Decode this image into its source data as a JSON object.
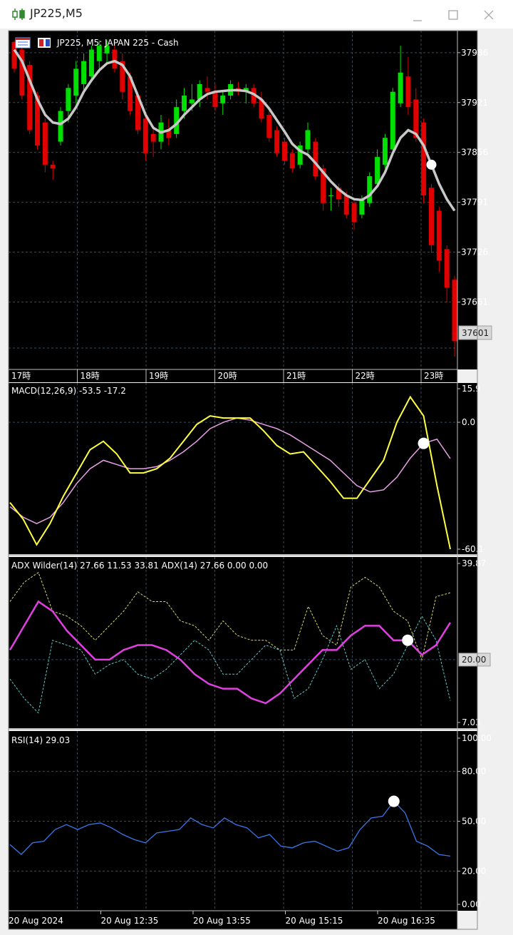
{
  "window": {
    "title": "JP225,M5",
    "title_icon": "candlestick-icon",
    "controls": [
      "minimize-icon",
      "maximize-icon",
      "close-icon"
    ]
  },
  "colors": {
    "background": "#000000",
    "grid": "#3a4a5a",
    "bull_candle": "#00e000",
    "bear_candle": "#e00000",
    "moving_average": "#c8c8c8",
    "macd_line": "#ffff40",
    "macd_signal": "#e8a0e8",
    "adx_line": "#e040e0",
    "plus_di": "#d8d870",
    "minus_di": "#60c8c8",
    "rsi_line": "#3878e8",
    "marker": "#ffffff"
  },
  "main_chart": {
    "header_icons": [
      "chart-window-icon",
      "one-click-trading-icon"
    ],
    "header": "JP225, M5:  JAPAN 225 - Cash",
    "price_ticks": [
      "37986",
      "37921",
      "37856",
      "37791",
      "37726",
      "37661",
      "37601"
    ],
    "current_price": "37601",
    "time_labels": [
      "17時",
      "18時",
      "19時",
      "20時",
      "21時",
      "22時",
      "23時"
    ]
  },
  "macd": {
    "label": "MACD(12,26,9) -53.5 -17.2",
    "ticks": [
      "15.9",
      "0.0",
      "-60.1"
    ]
  },
  "adx": {
    "label": "ADX Wilder(14) 27.66 11.53 33.81 ADX(14) 27.66 0.00 0.00",
    "ticks": [
      "39.87",
      "20.00",
      "7.03"
    ]
  },
  "rsi": {
    "label": "RSI(14) 29.03",
    "ticks": [
      "100.00",
      "80.00",
      "50.00",
      "20.00",
      "0.00"
    ]
  },
  "bottom_axis": [
    "20 Aug 2024",
    "20 Aug 12:35",
    "20 Aug 13:55",
    "20 Aug 15:15",
    "20 Aug 16:35"
  ],
  "chart_data": [
    {
      "type": "candlestick",
      "title": "JP225, M5:  JAPAN 225 - Cash",
      "ylim": [
        37575,
        38010
      ],
      "x_labels": [
        "17時",
        "18時",
        "19時",
        "20時",
        "21時",
        "22時",
        "23時"
      ],
      "candles": [
        {
          "o": 38000,
          "h": 38002,
          "l": 37960,
          "c": 37965
        },
        {
          "o": 37990,
          "h": 37995,
          "l": 37925,
          "c": 37930
        },
        {
          "o": 37970,
          "h": 37975,
          "l": 37880,
          "c": 37885
        },
        {
          "o": 37930,
          "h": 37935,
          "l": 37860,
          "c": 37865
        },
        {
          "o": 37895,
          "h": 37900,
          "l": 37830,
          "c": 37840
        },
        {
          "o": 37840,
          "h": 37845,
          "l": 37820,
          "c": 37835
        },
        {
          "o": 37870,
          "h": 37915,
          "l": 37865,
          "c": 37910
        },
        {
          "o": 37910,
          "h": 37945,
          "l": 37895,
          "c": 37940
        },
        {
          "o": 37930,
          "h": 37975,
          "l": 37920,
          "c": 37965
        },
        {
          "o": 37945,
          "h": 37985,
          "l": 37935,
          "c": 37975
        },
        {
          "o": 37955,
          "h": 37995,
          "l": 37950,
          "c": 37990
        },
        {
          "o": 37975,
          "h": 38002,
          "l": 37960,
          "c": 37995
        },
        {
          "o": 37985,
          "h": 38002,
          "l": 37970,
          "c": 37995
        },
        {
          "o": 37990,
          "h": 38002,
          "l": 37960,
          "c": 37965
        },
        {
          "o": 37975,
          "h": 37985,
          "l": 37925,
          "c": 37935
        },
        {
          "o": 37955,
          "h": 37960,
          "l": 37905,
          "c": 37910
        },
        {
          "o": 37930,
          "h": 37935,
          "l": 37880,
          "c": 37885
        },
        {
          "o": 37900,
          "h": 37905,
          "l": 37845,
          "c": 37855
        },
        {
          "o": 37880,
          "h": 37890,
          "l": 37850,
          "c": 37870
        },
        {
          "o": 37870,
          "h": 37905,
          "l": 37860,
          "c": 37895
        },
        {
          "o": 37885,
          "h": 37900,
          "l": 37865,
          "c": 37875
        },
        {
          "o": 37880,
          "h": 37925,
          "l": 37875,
          "c": 37915
        },
        {
          "o": 37910,
          "h": 37940,
          "l": 37900,
          "c": 37930
        },
        {
          "o": 37920,
          "h": 37945,
          "l": 37910,
          "c": 37925
        },
        {
          "o": 37925,
          "h": 37950,
          "l": 37915,
          "c": 37945
        },
        {
          "o": 37940,
          "h": 37955,
          "l": 37925,
          "c": 37935
        },
        {
          "o": 37935,
          "h": 37945,
          "l": 37910,
          "c": 37915
        },
        {
          "o": 37920,
          "h": 37935,
          "l": 37905,
          "c": 37930
        },
        {
          "o": 37930,
          "h": 37950,
          "l": 37925,
          "c": 37945
        },
        {
          "o": 37940,
          "h": 37948,
          "l": 37930,
          "c": 37935
        },
        {
          "o": 37935,
          "h": 37945,
          "l": 37920,
          "c": 37940
        },
        {
          "o": 37940,
          "h": 37945,
          "l": 37915,
          "c": 37920
        },
        {
          "o": 37925,
          "h": 37935,
          "l": 37895,
          "c": 37900
        },
        {
          "o": 37905,
          "h": 37910,
          "l": 37870,
          "c": 37875
        },
        {
          "o": 37885,
          "h": 37890,
          "l": 37850,
          "c": 37855
        },
        {
          "o": 37870,
          "h": 37875,
          "l": 37840,
          "c": 37845
        },
        {
          "o": 37855,
          "h": 37860,
          "l": 37830,
          "c": 37835
        },
        {
          "o": 37840,
          "h": 37870,
          "l": 37835,
          "c": 37865
        },
        {
          "o": 37860,
          "h": 37895,
          "l": 37855,
          "c": 37885
        },
        {
          "o": 37870,
          "h": 37875,
          "l": 37820,
          "c": 37825
        },
        {
          "o": 37835,
          "h": 37840,
          "l": 37780,
          "c": 37790
        },
        {
          "o": 37800,
          "h": 37810,
          "l": 37780,
          "c": 37800
        },
        {
          "o": 37810,
          "h": 37815,
          "l": 37785,
          "c": 37795
        },
        {
          "o": 37800,
          "h": 37805,
          "l": 37770,
          "c": 37775
        },
        {
          "o": 37790,
          "h": 37795,
          "l": 37755,
          "c": 37765
        },
        {
          "o": 37775,
          "h": 37800,
          "l": 37770,
          "c": 37795
        },
        {
          "o": 37790,
          "h": 37830,
          "l": 37785,
          "c": 37825
        },
        {
          "o": 37815,
          "h": 37860,
          "l": 37810,
          "c": 37850
        },
        {
          "o": 37840,
          "h": 37880,
          "l": 37835,
          "c": 37875
        },
        {
          "o": 37860,
          "h": 37940,
          "l": 37855,
          "c": 37935
        },
        {
          "o": 37920,
          "h": 37995,
          "l": 37915,
          "c": 37960
        },
        {
          "o": 37955,
          "h": 37980,
          "l": 37905,
          "c": 37915
        },
        {
          "o": 37925,
          "h": 37940,
          "l": 37870,
          "c": 37875
        },
        {
          "o": 37895,
          "h": 37900,
          "l": 37790,
          "c": 37800
        },
        {
          "o": 37810,
          "h": 37815,
          "l": 37725,
          "c": 37735
        },
        {
          "o": 37780,
          "h": 37785,
          "l": 37700,
          "c": 37715
        },
        {
          "o": 37730,
          "h": 37735,
          "l": 37660,
          "c": 37680
        },
        {
          "o": 37690,
          "h": 37695,
          "l": 37590,
          "c": 37610
        }
      ],
      "moving_average": [
        37990,
        37975,
        37950,
        37925,
        37905,
        37895,
        37893,
        37900,
        37915,
        37935,
        37950,
        37963,
        37972,
        37975,
        37970,
        37955,
        37930,
        37905,
        37888,
        37882,
        37885,
        37893,
        37905,
        37915,
        37925,
        37932,
        37935,
        37936,
        37937,
        37937,
        37936,
        37932,
        37925,
        37913,
        37898,
        37883,
        37867,
        37858,
        37853,
        37842,
        37830,
        37818,
        37808,
        37800,
        37795,
        37794,
        37800,
        37812,
        37830,
        37855,
        37875,
        37885,
        37880,
        37865,
        37840,
        37815,
        37795,
        37780
      ]
    },
    {
      "type": "line",
      "title": "MACD(12,26,9) -53.5 -17.2",
      "ylim": [
        -60.1,
        15.9
      ],
      "series": [
        {
          "name": "MACD",
          "values": [
            -38,
            -46,
            -58,
            -48,
            -35,
            -24,
            -13,
            -9,
            -15,
            -24,
            -24,
            -22,
            -17,
            -9,
            -1,
            3,
            2,
            2,
            2,
            -4,
            -11,
            -15,
            -14,
            -21,
            -28,
            -36,
            -36,
            -27,
            -18,
            0,
            12,
            3,
            -30,
            -60.1
          ]
        },
        {
          "name": "Signal",
          "values": [
            -40,
            -45,
            -48,
            -45,
            -38,
            -29,
            -22,
            -18,
            -20,
            -22,
            -22,
            -21,
            -18,
            -14,
            -9,
            -3,
            0,
            2,
            1,
            -1,
            -3,
            -6,
            -10,
            -14,
            -18,
            -24,
            -30,
            -33,
            -32,
            -26,
            -17,
            -10,
            -8,
            -17.2
          ]
        }
      ]
    },
    {
      "type": "line",
      "title": "ADX Wilder(14) 27.66 11.53 33.81 ADX(14) 27.66 0.00 0.00",
      "ylim": [
        7.03,
        39.87
      ],
      "series": [
        {
          "name": "ADX",
          "values": [
            22,
            27,
            32,
            30,
            26,
            23,
            20,
            20,
            22,
            23,
            23,
            22,
            20,
            17,
            15,
            14,
            14,
            12,
            11,
            13,
            16,
            19,
            22,
            22,
            25,
            27,
            27,
            24,
            24,
            21,
            23,
            27.66
          ]
        },
        {
          "name": "+DI",
          "values": [
            32,
            36,
            38,
            30,
            29,
            27,
            24,
            27,
            30,
            34,
            32,
            32,
            28,
            27,
            24,
            28,
            25,
            24,
            24,
            22,
            22,
            31,
            25,
            23,
            35,
            37,
            35,
            30,
            28,
            20,
            33,
            33.81
          ]
        },
        {
          "name": "-DI",
          "values": [
            16,
            12,
            9,
            24,
            23,
            22,
            17,
            19,
            20,
            17,
            16,
            18,
            21,
            24,
            22,
            17,
            17,
            20,
            23,
            22,
            12,
            14,
            20,
            27,
            18,
            20,
            14,
            17,
            23,
            29,
            24,
            11.53
          ]
        }
      ]
    },
    {
      "type": "line",
      "title": "RSI(14) 29.03",
      "ylim": [
        0,
        100
      ],
      "y_ticks": [
        80,
        50,
        20
      ],
      "series": [
        {
          "name": "RSI",
          "values": [
            36,
            30,
            37,
            38,
            45,
            48,
            45,
            48,
            49,
            46,
            42,
            39,
            37,
            43,
            44,
            45,
            52,
            48,
            46,
            52,
            48,
            46,
            40,
            42,
            35,
            34,
            37,
            38,
            35,
            32,
            34,
            45,
            52,
            53,
            62,
            55,
            38,
            35,
            30,
            29.03
          ]
        }
      ]
    }
  ]
}
